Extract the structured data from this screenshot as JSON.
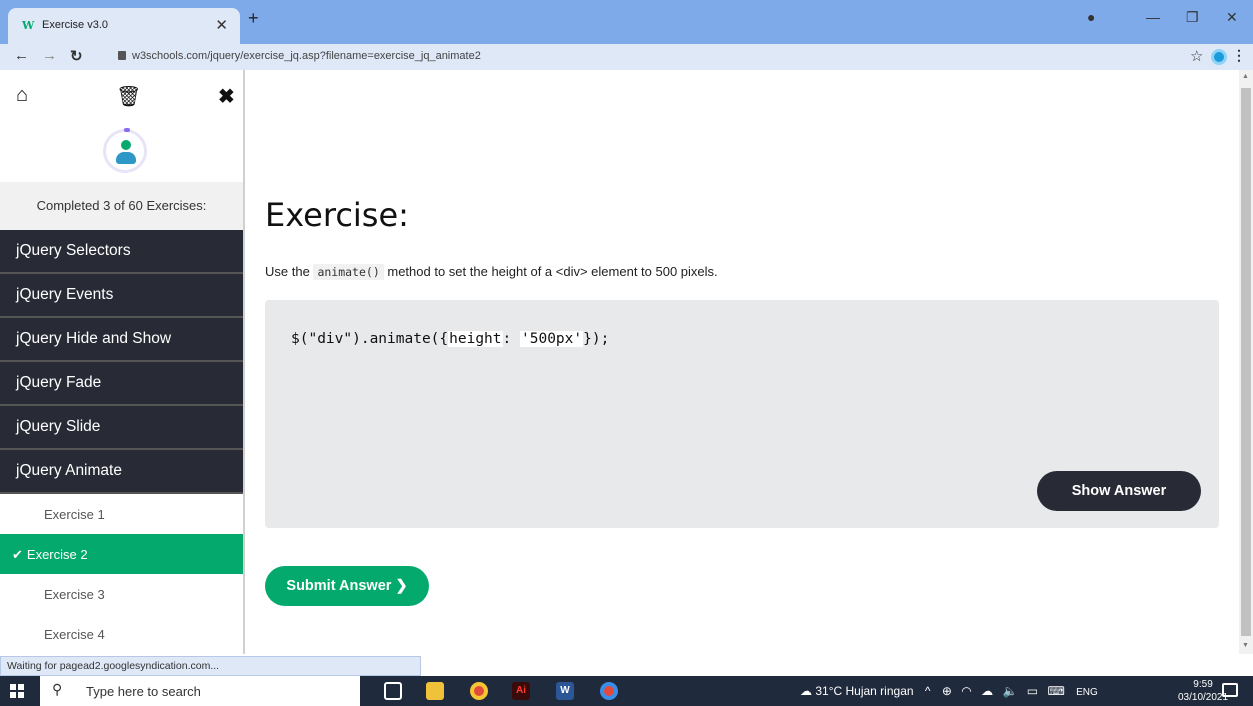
{
  "browser": {
    "tab_title": "Exercise v3.0",
    "tab_favicon": "W",
    "url": "w3schools.com/jquery/exercise_jq.asp?filename=exercise_jq_animate2",
    "status_text": "Waiting for pagead2.googlesyndication.com..."
  },
  "sidebar": {
    "progress_text": "Completed 3 of 60 Exercises:",
    "categories": [
      {
        "label": "jQuery Selectors"
      },
      {
        "label": "jQuery Events"
      },
      {
        "label": "jQuery Hide and Show"
      },
      {
        "label": "jQuery Fade"
      },
      {
        "label": "jQuery Slide"
      },
      {
        "label": "jQuery Animate"
      }
    ],
    "exercises": [
      {
        "label": "Exercise 1"
      },
      {
        "label": "Exercise 2"
      },
      {
        "label": "Exercise 3"
      },
      {
        "label": "Exercise 4"
      }
    ]
  },
  "main": {
    "heading": "Exercise:",
    "instruction_pre": "Use the",
    "instruction_code": "animate()",
    "instruction_post": "method to set the height of a <div> element to 500 pixels.",
    "code_prefix": "$(\"div\").animate({",
    "code_field1": "height",
    "code_middle": ": ",
    "code_field2": "'500px'",
    "code_suffix": "});",
    "show_answer_label": "Show Answer",
    "submit_label": "Submit Answer ❯"
  },
  "taskbar": {
    "search_placeholder": "Type here to search",
    "weather": "31°C  Hujan ringan",
    "language": "ENG",
    "time": "9:59",
    "date": "03/10/2021"
  },
  "colors": {
    "accent_green": "#04aa6d",
    "dark": "#282a35"
  }
}
